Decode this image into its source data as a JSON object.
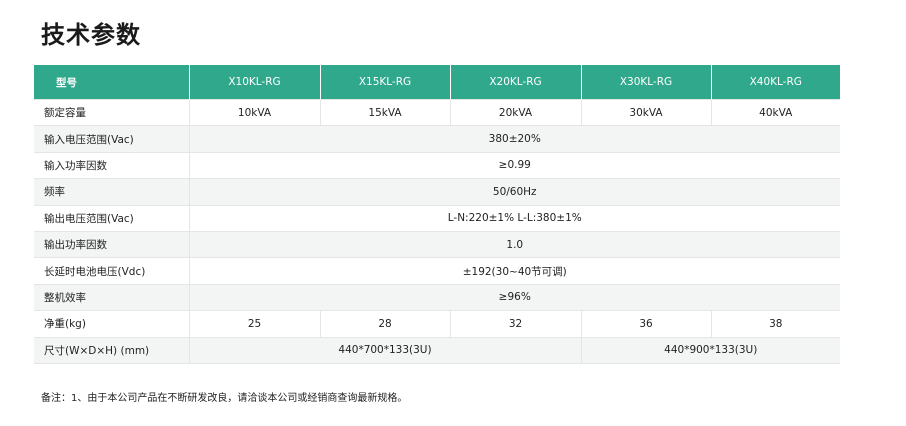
{
  "page_title": "技术参数",
  "table": {
    "header": [
      "型号",
      "X10KL-RG",
      "X15KL-RG",
      "X20KL-RG",
      "X30KL-RG",
      "X40KL-RG"
    ],
    "rows": {
      "capacity": {
        "label": "额定容量",
        "values": [
          "10kVA",
          "15kVA",
          "20kVA",
          "30kVA",
          "40kVA"
        ]
      },
      "input_voltage": {
        "label": "输入电压范围(Vac)",
        "value": "380±20%"
      },
      "input_pf": {
        "label": "输入功率因数",
        "value": "≥0.99"
      },
      "frequency": {
        "label": "频率",
        "value": "50/60Hz"
      },
      "output_voltage": {
        "label": "输出电压范围(Vac)",
        "value": "L-N:220±1%  L-L:380±1%"
      },
      "output_pf": {
        "label": "输出功率因数",
        "value": "1.0"
      },
      "battery_voltage": {
        "label": "长延时电池电压(Vdc)",
        "value": "±192(30~40节可调)"
      },
      "efficiency": {
        "label": "整机效率",
        "value": "≥96%"
      },
      "weight": {
        "label": "净重(kg)",
        "values": [
          "25",
          "28",
          "32",
          "36",
          "38"
        ]
      },
      "dimensions": {
        "label": "尺寸(W×D×H) (mm)",
        "values": [
          "440*700*133(3U)",
          "440*900*133(3U)"
        ]
      }
    }
  },
  "footnote": "备注：1、由于本公司产品在不断研发改良，请洽谈本公司或经销商查询最新规格。"
}
